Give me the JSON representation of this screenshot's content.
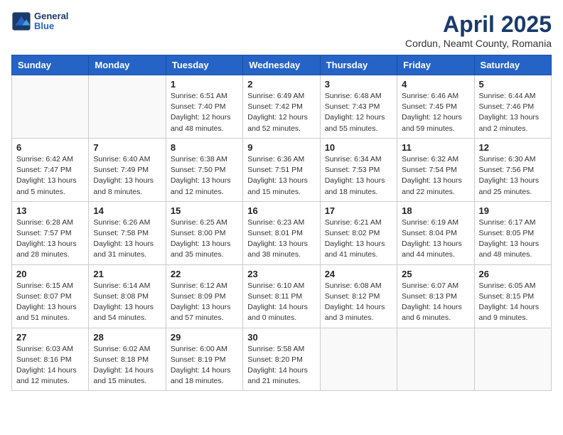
{
  "header": {
    "logo_line1": "General",
    "logo_line2": "Blue",
    "title": "April 2025",
    "subtitle": "Cordun, Neamt County, Romania"
  },
  "weekdays": [
    "Sunday",
    "Monday",
    "Tuesday",
    "Wednesday",
    "Thursday",
    "Friday",
    "Saturday"
  ],
  "weeks": [
    [
      {
        "day": "",
        "info": ""
      },
      {
        "day": "",
        "info": ""
      },
      {
        "day": "1",
        "info": "Sunrise: 6:51 AM\nSunset: 7:40 PM\nDaylight: 12 hours and 48 minutes."
      },
      {
        "day": "2",
        "info": "Sunrise: 6:49 AM\nSunset: 7:42 PM\nDaylight: 12 hours and 52 minutes."
      },
      {
        "day": "3",
        "info": "Sunrise: 6:48 AM\nSunset: 7:43 PM\nDaylight: 12 hours and 55 minutes."
      },
      {
        "day": "4",
        "info": "Sunrise: 6:46 AM\nSunset: 7:45 PM\nDaylight: 12 hours and 59 minutes."
      },
      {
        "day": "5",
        "info": "Sunrise: 6:44 AM\nSunset: 7:46 PM\nDaylight: 13 hours and 2 minutes."
      }
    ],
    [
      {
        "day": "6",
        "info": "Sunrise: 6:42 AM\nSunset: 7:47 PM\nDaylight: 13 hours and 5 minutes."
      },
      {
        "day": "7",
        "info": "Sunrise: 6:40 AM\nSunset: 7:49 PM\nDaylight: 13 hours and 8 minutes."
      },
      {
        "day": "8",
        "info": "Sunrise: 6:38 AM\nSunset: 7:50 PM\nDaylight: 13 hours and 12 minutes."
      },
      {
        "day": "9",
        "info": "Sunrise: 6:36 AM\nSunset: 7:51 PM\nDaylight: 13 hours and 15 minutes."
      },
      {
        "day": "10",
        "info": "Sunrise: 6:34 AM\nSunset: 7:53 PM\nDaylight: 13 hours and 18 minutes."
      },
      {
        "day": "11",
        "info": "Sunrise: 6:32 AM\nSunset: 7:54 PM\nDaylight: 13 hours and 22 minutes."
      },
      {
        "day": "12",
        "info": "Sunrise: 6:30 AM\nSunset: 7:56 PM\nDaylight: 13 hours and 25 minutes."
      }
    ],
    [
      {
        "day": "13",
        "info": "Sunrise: 6:28 AM\nSunset: 7:57 PM\nDaylight: 13 hours and 28 minutes."
      },
      {
        "day": "14",
        "info": "Sunrise: 6:26 AM\nSunset: 7:58 PM\nDaylight: 13 hours and 31 minutes."
      },
      {
        "day": "15",
        "info": "Sunrise: 6:25 AM\nSunset: 8:00 PM\nDaylight: 13 hours and 35 minutes."
      },
      {
        "day": "16",
        "info": "Sunrise: 6:23 AM\nSunset: 8:01 PM\nDaylight: 13 hours and 38 minutes."
      },
      {
        "day": "17",
        "info": "Sunrise: 6:21 AM\nSunset: 8:02 PM\nDaylight: 13 hours and 41 minutes."
      },
      {
        "day": "18",
        "info": "Sunrise: 6:19 AM\nSunset: 8:04 PM\nDaylight: 13 hours and 44 minutes."
      },
      {
        "day": "19",
        "info": "Sunrise: 6:17 AM\nSunset: 8:05 PM\nDaylight: 13 hours and 48 minutes."
      }
    ],
    [
      {
        "day": "20",
        "info": "Sunrise: 6:15 AM\nSunset: 8:07 PM\nDaylight: 13 hours and 51 minutes."
      },
      {
        "day": "21",
        "info": "Sunrise: 6:14 AM\nSunset: 8:08 PM\nDaylight: 13 hours and 54 minutes."
      },
      {
        "day": "22",
        "info": "Sunrise: 6:12 AM\nSunset: 8:09 PM\nDaylight: 13 hours and 57 minutes."
      },
      {
        "day": "23",
        "info": "Sunrise: 6:10 AM\nSunset: 8:11 PM\nDaylight: 14 hours and 0 minutes."
      },
      {
        "day": "24",
        "info": "Sunrise: 6:08 AM\nSunset: 8:12 PM\nDaylight: 14 hours and 3 minutes."
      },
      {
        "day": "25",
        "info": "Sunrise: 6:07 AM\nSunset: 8:13 PM\nDaylight: 14 hours and 6 minutes."
      },
      {
        "day": "26",
        "info": "Sunrise: 6:05 AM\nSunset: 8:15 PM\nDaylight: 14 hours and 9 minutes."
      }
    ],
    [
      {
        "day": "27",
        "info": "Sunrise: 6:03 AM\nSunset: 8:16 PM\nDaylight: 14 hours and 12 minutes."
      },
      {
        "day": "28",
        "info": "Sunrise: 6:02 AM\nSunset: 8:18 PM\nDaylight: 14 hours and 15 minutes."
      },
      {
        "day": "29",
        "info": "Sunrise: 6:00 AM\nSunset: 8:19 PM\nDaylight: 14 hours and 18 minutes."
      },
      {
        "day": "30",
        "info": "Sunrise: 5:58 AM\nSunset: 8:20 PM\nDaylight: 14 hours and 21 minutes."
      },
      {
        "day": "",
        "info": ""
      },
      {
        "day": "",
        "info": ""
      },
      {
        "day": "",
        "info": ""
      }
    ]
  ]
}
